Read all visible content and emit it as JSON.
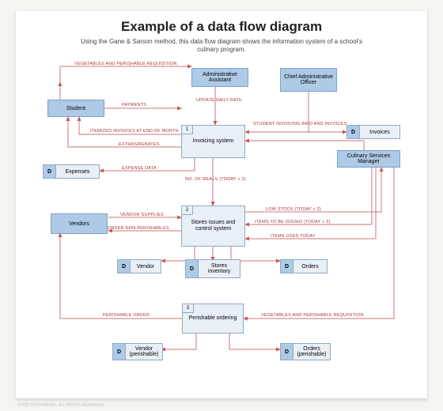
{
  "title": "Example of a data flow diagram",
  "subtitle": "Using the Gane & Sarson method, this data flow diagram shows the information system of a school's culinary program.",
  "entities": {
    "student": "Student",
    "admin_assistant": "Administrative Assistant",
    "chief_admin": "Chief Administrative Officer",
    "culinary_mgr": "Culinary Services Manager",
    "vendors": "Vendors"
  },
  "processes": {
    "p1": {
      "num": "1",
      "label": "Invoicing system"
    },
    "p2": {
      "num": "2",
      "label": "Stores issues and control system"
    },
    "p3": {
      "num": "3",
      "label": "Perishable ordering"
    }
  },
  "datastores": {
    "expenses": "Expenses",
    "invoices": "Invoices",
    "vendor": "Vendor",
    "stores_inv": "Stores inventory",
    "orders": "Orders",
    "vendor_per": "Vendor (perishable)",
    "orders_per": "Orders (perishable)"
  },
  "d_letter": "D",
  "flows": {
    "veg_req_top": "VEGETABLES AND PERISHABLE REQUISITION",
    "payments": "PAYMENTS",
    "update_daily": "UPDATE DAILY RATE",
    "itemized": "ITEMIZED INVOICES AT END OF MONTH",
    "student_inv": "STUDENT INVOICING INFO AND INVOICES",
    "extras": "EXTRAS/REBATES",
    "expense_data": "EXPENSE DATA",
    "meals": "NO. OF MEALS (TODAY + 3)",
    "low_stock": "LOW STOCK (TODAY + 2)",
    "vendor_supplies": "VENDOR SUPPLIES",
    "items_issued": "ITEMS TO BE ISSUED (TODAY + 2)",
    "order_nonper": "ORDER NON-PERISHABLES",
    "items_used": "ITEMS USED TODAY",
    "per_order": "PERISHABLE ORDER",
    "veg_req_bot": "VEGETABLES AND PERISHABLE REQUISITION"
  },
  "footer": "©2022 TECHTARGET. ALL RIGHTS RESERVED"
}
